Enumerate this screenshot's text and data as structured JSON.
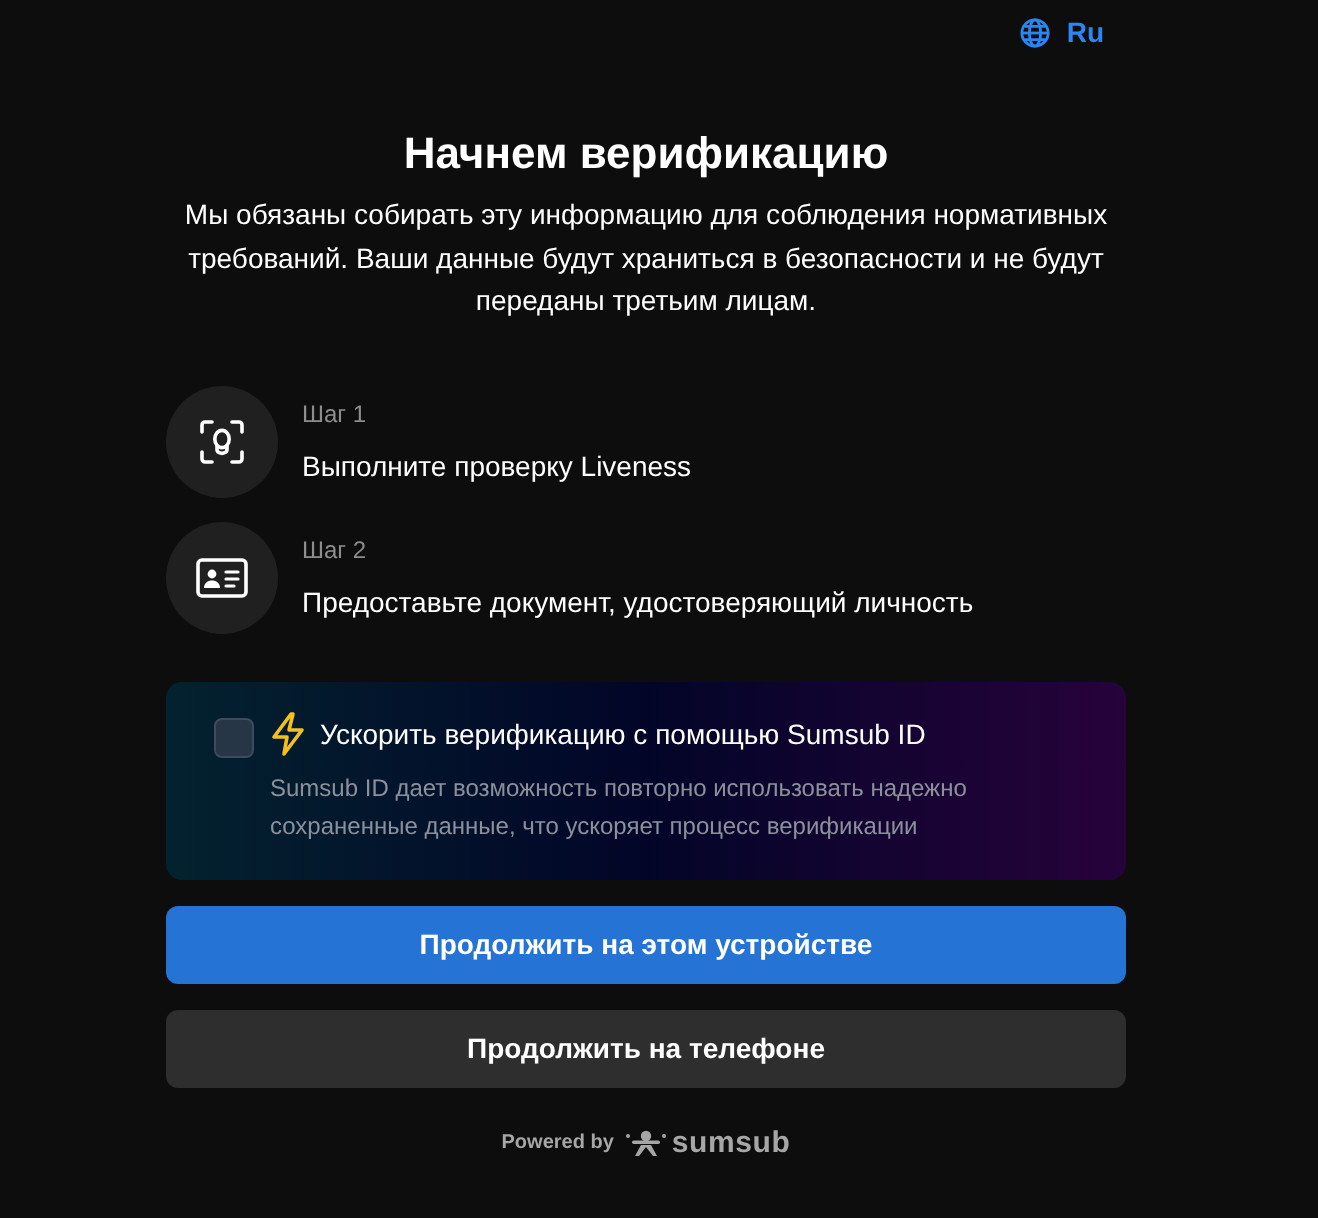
{
  "language": {
    "label": "Ru"
  },
  "header": {
    "title": "Начнем верификацию",
    "description": "Мы обязаны собирать эту информацию для соблюдения нормативных требований. Ваши данные будут храниться в безопасности и не будут переданы третьим лицам."
  },
  "steps": [
    {
      "kind": "face",
      "label": "Шаг 1",
      "title": "Выполните проверку Liveness"
    },
    {
      "kind": "document",
      "label": "Шаг 2",
      "title": "Предоставьте документ, удостоверяющий личность"
    }
  ],
  "sumsub_id": {
    "checked": false,
    "title": "Ускорить верификацию с помощью Sumsub ID",
    "description": "Sumsub ID дает возможность повторно использовать надежно сохраненные данные, что ускоряет процесс верификации"
  },
  "buttons": [
    {
      "kind": "primary",
      "label": "Продолжить на этом устройстве"
    },
    {
      "kind": "secondary",
      "label": "Продолжить на телефоне"
    }
  ],
  "footer": {
    "powered_by": "Powered by",
    "brand": "sumsub"
  }
}
